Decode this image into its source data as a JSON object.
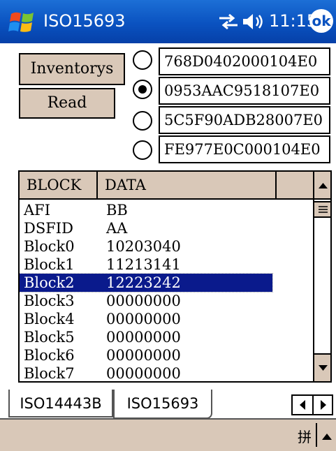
{
  "titlebar": {
    "title": "ISO15693",
    "time": "11:15",
    "ok_label": "ok"
  },
  "buttons": {
    "inventory": "Inventorys",
    "read": "Read"
  },
  "tags": [
    {
      "uid": "768D0402000104E0",
      "selected": false
    },
    {
      "uid": "0953AAC9518107E0",
      "selected": true
    },
    {
      "uid": "5C5F90ADB28007E0",
      "selected": false
    },
    {
      "uid": "FE977E0C000104E0",
      "selected": false
    }
  ],
  "list": {
    "headers": [
      "BLOCK",
      "DATA"
    ],
    "rows": [
      {
        "block": "AFI",
        "data": "BB"
      },
      {
        "block": "DSFID",
        "data": "AA"
      },
      {
        "block": "Block0",
        "data": "10203040"
      },
      {
        "block": "Block1",
        "data": "11213141"
      },
      {
        "block": "Block2",
        "data": "12223242",
        "selected": true
      },
      {
        "block": "Block3",
        "data": "00000000"
      },
      {
        "block": "Block4",
        "data": "00000000"
      },
      {
        "block": "Block5",
        "data": "00000000"
      },
      {
        "block": "Block6",
        "data": "00000000"
      },
      {
        "block": "Block7",
        "data": "00000000"
      }
    ]
  },
  "tabs": [
    {
      "label": "ISO14443B",
      "active": false
    },
    {
      "label": "ISO15693",
      "active": true
    }
  ],
  "menubar": {
    "ime_label": "拼"
  },
  "colors": {
    "titlebar": "#0a52c0",
    "chrome": "#d9c8b8",
    "selection": "#0a1a8c"
  },
  "icons": [
    "windows-start-icon",
    "connectivity-icon",
    "volume-icon",
    "ok-icon",
    "scroll-up-icon",
    "scroll-down-icon",
    "tab-left-icon",
    "tab-right-icon",
    "ime-up-arrow-icon"
  ]
}
